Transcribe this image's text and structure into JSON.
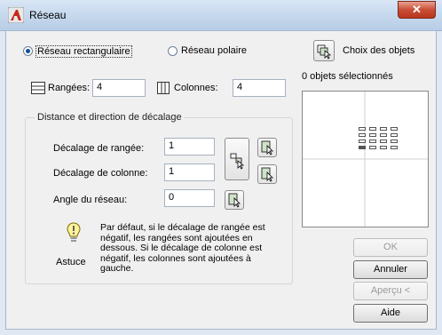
{
  "window": {
    "title": "Réseau",
    "close_glyph": "✕"
  },
  "mode": {
    "rect_label": "Réseau rectangulaire",
    "rect_selected": true,
    "polar_label": "Réseau polaire",
    "polar_selected": false
  },
  "select_objects": {
    "label": "Choix des objets",
    "count_text": "0 objets sélectionnés"
  },
  "rows": {
    "label": "Rangées:",
    "value": "4",
    "icon": "rows-icon"
  },
  "columns": {
    "label": "Colonnes:",
    "value": "4",
    "icon": "columns-icon"
  },
  "offset_group": {
    "title": "Distance et direction de décalage",
    "row_offset_label": "Décalage de rangée:",
    "row_offset_value": "1",
    "col_offset_label": "Décalage de colonne:",
    "col_offset_value": "1",
    "angle_label": "Angle du réseau:",
    "angle_value": "0"
  },
  "tip": {
    "label": "Astuce",
    "icon": "lightbulb-icon",
    "text": "Par défaut, si le décalage de rangée est négatif, les rangées sont ajoutées en dessous. Si le décalage de colonne est négatif, les colonnes sont ajoutées à gauche."
  },
  "buttons": {
    "ok": "OK",
    "cancel": "Annuler",
    "preview": "Aperçu <",
    "help": "Aide"
  }
}
